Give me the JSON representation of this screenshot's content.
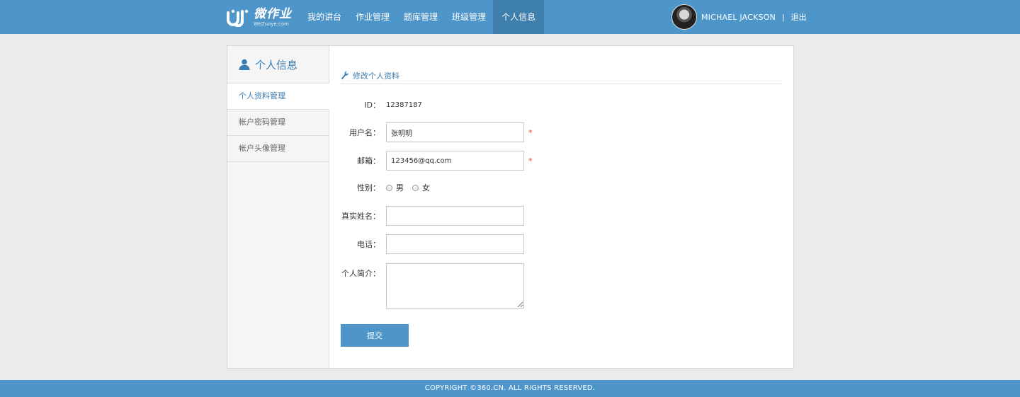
{
  "header": {
    "logo": {
      "cn": "微作业",
      "en": "WeZuoye.com"
    },
    "nav": [
      "我的讲台",
      "作业管理",
      "题库管理",
      "班级管理",
      "个人信息"
    ],
    "active_nav": "个人信息",
    "user_name": "MICHAEL JACKSON",
    "separator": "|",
    "logout": "退出"
  },
  "sidebar": {
    "title": "个人信息",
    "items": [
      {
        "label": "个人资料管理"
      },
      {
        "label": "帐户密码管理"
      },
      {
        "label": "帐户头像管理"
      }
    ],
    "active_item": "个人资料管理"
  },
  "form": {
    "section_title": "修改个人资料",
    "id_label": "ID：",
    "id_value": "12387187",
    "username_label": "用户名：",
    "username_value": "张明明",
    "email_label": "邮箱：",
    "email_value": "123456@qq.com",
    "required_mark": "*",
    "gender_label": "性别：",
    "gender_options": [
      "男",
      "女"
    ],
    "realname_label": "真实姓名：",
    "realname_value": "",
    "phone_label": "电话：",
    "phone_value": "",
    "bio_label": "个人简介：",
    "bio_value": "",
    "submit_label": "提交"
  },
  "footer": {
    "copyright": "COPYRIGHT ©360.CN. ALL RIGHTS RESERVED."
  },
  "colors": {
    "brand": "#4e95c9",
    "nav_active": "#3f7fae",
    "link": "#3c7db3",
    "required": "#ee3333"
  }
}
